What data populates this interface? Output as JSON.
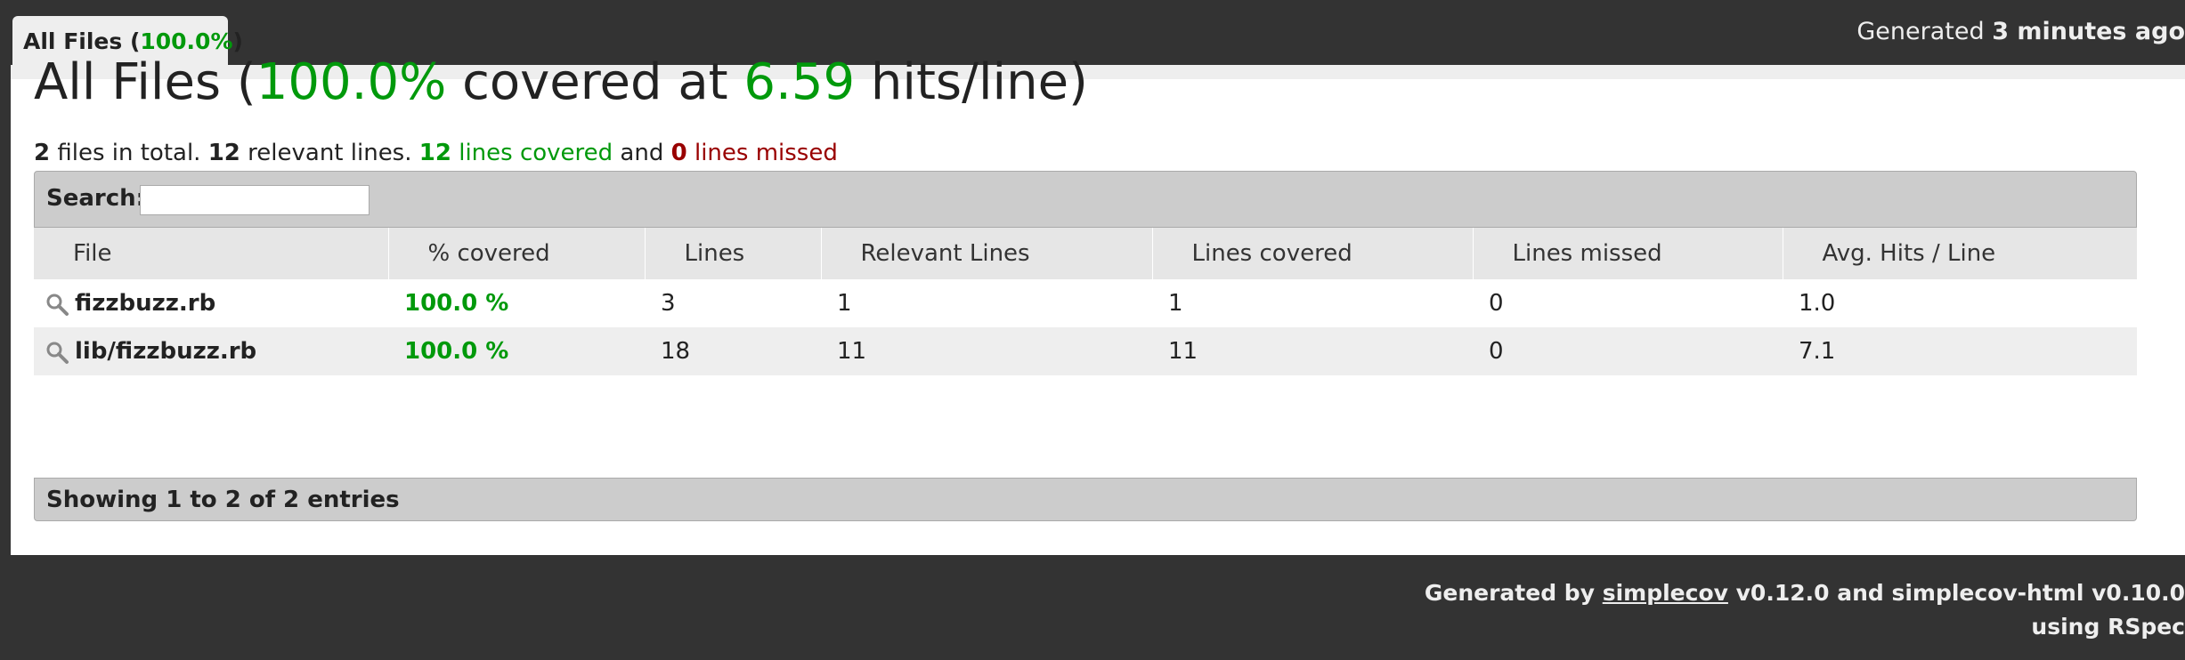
{
  "tab": {
    "label_prefix": "All Files (",
    "percent": "100.0%",
    "label_suffix": ")"
  },
  "generated": {
    "prefix": "Generated",
    "time": "3 minutes ago"
  },
  "heading": {
    "prefix": "All Files (",
    "percent": "100.0%",
    "middle": " covered at ",
    "hits": "6.59",
    "suffix": " hits/line)"
  },
  "summary": {
    "files_count": "2",
    "files_text": " files in total. ",
    "relevant_count": "12",
    "relevant_text": " relevant lines. ",
    "covered_count": "12",
    "covered_text": " lines covered",
    "and_text": " and ",
    "missed_count": "0",
    "missed_text": " lines missed"
  },
  "search": {
    "label": "Search:",
    "value": "",
    "placeholder": ""
  },
  "table": {
    "headers": [
      "File",
      "% covered",
      "Lines",
      "Relevant Lines",
      "Lines covered",
      "Lines missed",
      "Avg. Hits / Line"
    ],
    "rows": [
      {
        "file": "fizzbuzz.rb",
        "covered": "100.0 %",
        "lines": "3",
        "relevant": "1",
        "lines_covered": "1",
        "missed": "0",
        "avg": "1.0"
      },
      {
        "file": "lib/fizzbuzz.rb",
        "covered": "100.0 %",
        "lines": "18",
        "relevant": "11",
        "lines_covered": "11",
        "missed": "0",
        "avg": "7.1"
      }
    ]
  },
  "info": "Showing 1 to 2 of 2 entries",
  "footer": {
    "generated_by": "Generated by ",
    "simplecov_link": "simplecov",
    "versions": " v0.12.0 and simplecov-html v0.10.0",
    "using": "using RSpec"
  },
  "colors": {
    "background": "#333333",
    "covered_green": "#00990b",
    "missed_red": "#990000"
  },
  "icons": {
    "file_row": "magnifier-icon"
  }
}
